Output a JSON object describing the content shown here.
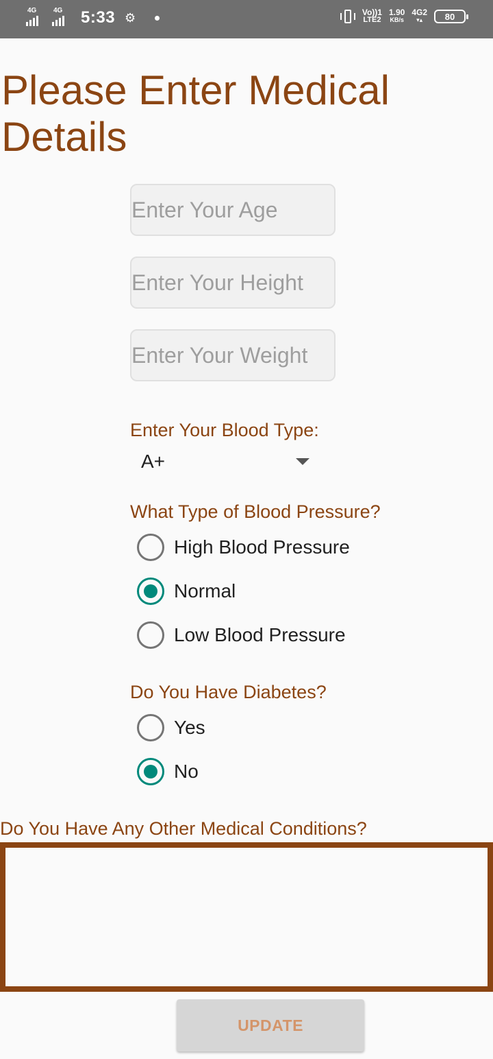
{
  "status_bar": {
    "network_1": "4G",
    "network_2": "4G",
    "time": "5:33",
    "volte_top": "Vo))1",
    "volte_bottom": "LTE2",
    "speed_value": "1.90",
    "speed_unit": "KB/s",
    "network_3": "4G2",
    "battery": "80"
  },
  "page": {
    "title": "Please Enter Medical Details"
  },
  "fields": {
    "age_placeholder": "Enter Your Age",
    "height_placeholder": "Enter Your Height",
    "weight_placeholder": "Enter Your Weight",
    "age_value": "",
    "height_value": "",
    "weight_value": ""
  },
  "blood_type": {
    "label": "Enter Your Blood Type:",
    "selected": "A+"
  },
  "blood_pressure": {
    "label": "What Type of Blood Pressure?",
    "options": [
      "High Blood Pressure",
      "Normal",
      "Low Blood Pressure"
    ],
    "selected": "Normal"
  },
  "diabetes": {
    "label": "Do You Have Diabetes?",
    "options": [
      "Yes",
      "No"
    ],
    "selected": "No"
  },
  "other_conditions": {
    "label": "Do You Have Any Other Medical Conditions?",
    "value": ""
  },
  "update_button": "UPDATE",
  "colors": {
    "accent": "#8b4513",
    "radio_checked": "#00897b",
    "status_bar": "#6f6f6f"
  }
}
